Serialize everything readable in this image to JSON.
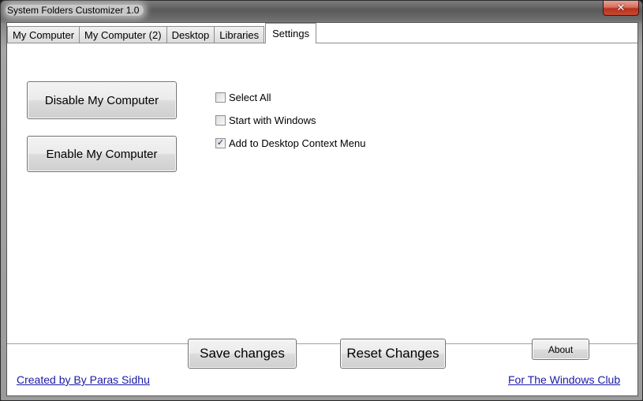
{
  "window": {
    "title": "System Folders Customizer 1.0",
    "close_glyph": "✕"
  },
  "tabs": [
    {
      "label": "My Computer"
    },
    {
      "label": "My Computer (2)"
    },
    {
      "label": "Desktop"
    },
    {
      "label": "Libraries"
    },
    {
      "label": "Settings",
      "active": true
    }
  ],
  "settings": {
    "disable_label": "Disable My Computer",
    "enable_label": "Enable My Computer",
    "options": [
      {
        "label": "Select All",
        "checked": false
      },
      {
        "label": "Start with Windows",
        "checked": false
      },
      {
        "label": "Add to Desktop Context Menu",
        "checked": true
      }
    ],
    "check_glyph": "✓"
  },
  "footer": {
    "save_label": "Save changes",
    "reset_label": "Reset Changes",
    "about_label": "About",
    "credit_link": "Created by By Paras Sidhu",
    "club_link": "For The Windows Club"
  },
  "colors": {
    "link": "#1a1aa6",
    "close_button": "#c84a34"
  }
}
